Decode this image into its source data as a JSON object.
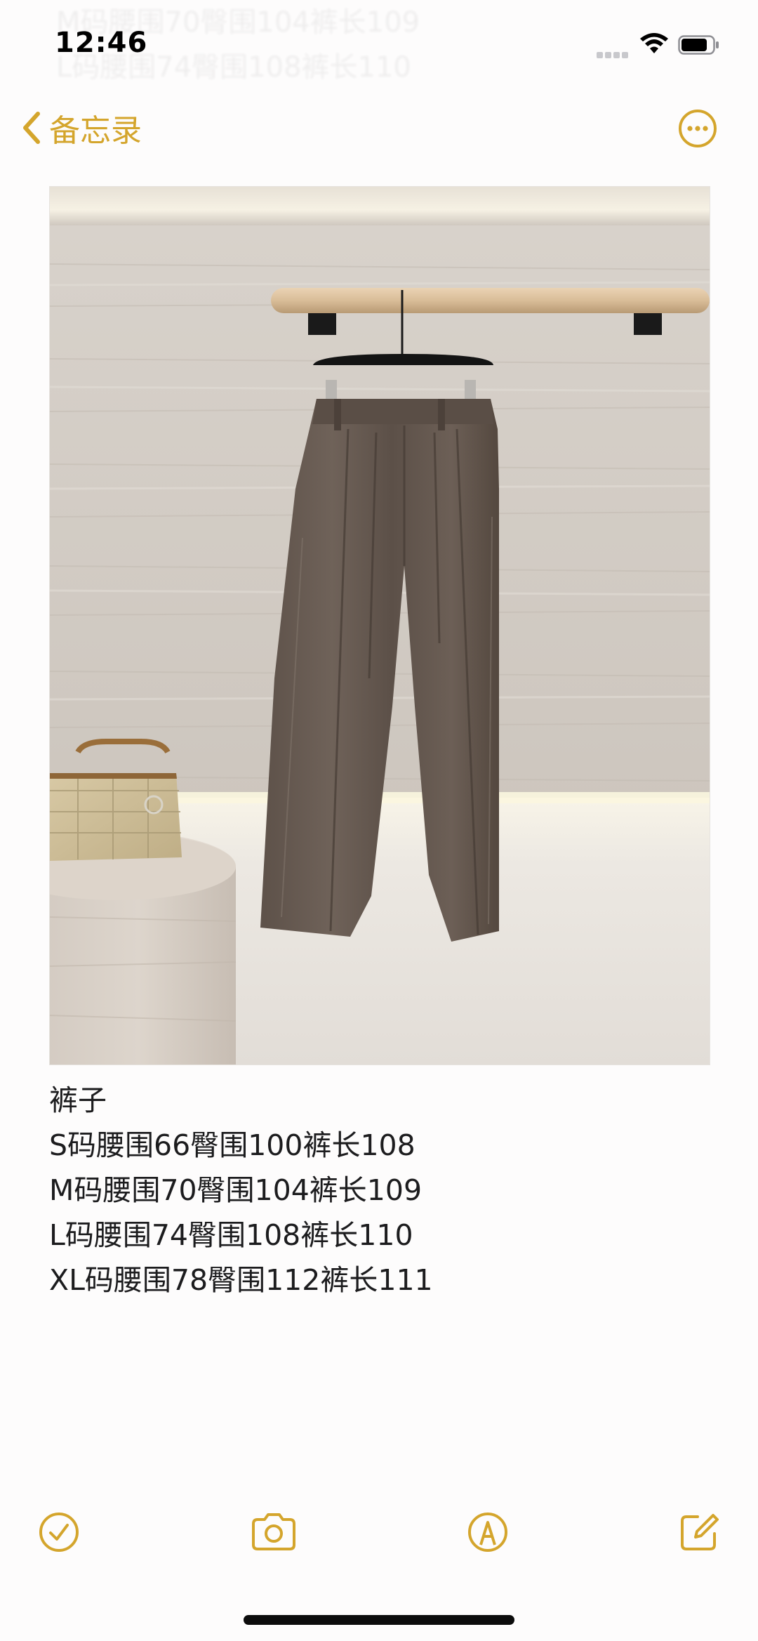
{
  "status_bar": {
    "time": "12:46"
  },
  "navigation": {
    "back_label": "备忘录",
    "back_icon": "chevron-left-icon",
    "more_icon": "ellipsis-circle-icon"
  },
  "note": {
    "photo_subject": "product-photo",
    "lines": [
      "裤子",
      "S码腰围66臀围100裤长108",
      "M码腰围70臀围104裤长109",
      "L码腰围74臀围108裤长110",
      "XL码腰围78臀围112裤长111"
    ]
  },
  "toolbar": {
    "icons": [
      "checklist-icon",
      "camera-icon",
      "markup-icon",
      "compose-icon"
    ]
  },
  "colors": {
    "accent": "#d4a52c",
    "background": "#fdfcfc",
    "text": "#1c1c1e"
  }
}
